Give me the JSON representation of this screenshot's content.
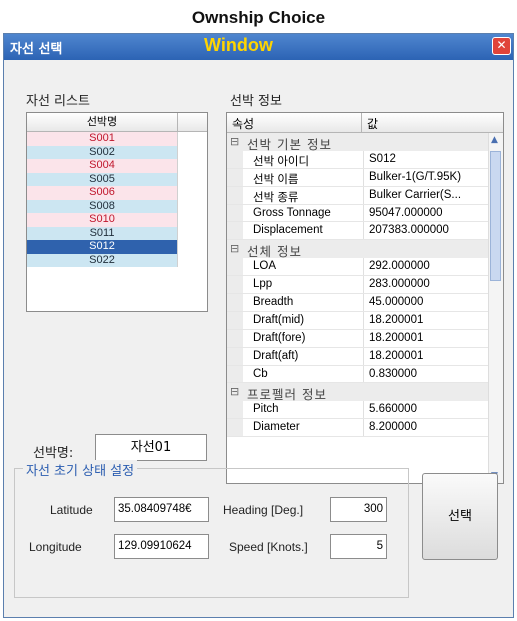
{
  "caption": {
    "line1": "Ownship Choice",
    "line2": "Window"
  },
  "window": {
    "title": "자선 선택",
    "close_glyph": "✕"
  },
  "ship_list": {
    "label": "자선 리스트",
    "column": "선박명",
    "items": [
      "S001",
      "S002",
      "S004",
      "S005",
      "S006",
      "S008",
      "S010",
      "S011",
      "S012",
      "S022"
    ],
    "selected": "S012"
  },
  "ship_name": {
    "label": "선박명:",
    "value": "자선01"
  },
  "ship_info": {
    "label": "선박 정보",
    "columns": {
      "attr": "속성",
      "value": "값"
    },
    "categories": [
      {
        "name": "선박 기본 정보",
        "rows": [
          {
            "key": "선박 아이디",
            "value": "S012"
          },
          {
            "key": "선박 이름",
            "value": "Bulker-1(G/T.95K)"
          },
          {
            "key": "선박 종류",
            "value": "Bulker Carrier(S..."
          },
          {
            "key": "Gross Tonnage",
            "value": "95047.000000"
          },
          {
            "key": "Displacement",
            "value": "207383.000000"
          }
        ]
      },
      {
        "name": "선체 정보",
        "rows": [
          {
            "key": "LOA",
            "value": "292.000000"
          },
          {
            "key": "Lpp",
            "value": "283.000000"
          },
          {
            "key": "Breadth",
            "value": "45.000000"
          },
          {
            "key": "Draft(mid)",
            "value": "18.200001"
          },
          {
            "key": "Draft(fore)",
            "value": "18.200001"
          },
          {
            "key": "Draft(aft)",
            "value": "18.200001"
          },
          {
            "key": "Cb",
            "value": "0.830000"
          }
        ]
      },
      {
        "name": "프로펠러 정보",
        "rows": [
          {
            "key": "Pitch",
            "value": "5.660000"
          },
          {
            "key": "Diameter",
            "value": "8.200000"
          }
        ]
      }
    ]
  },
  "init_state": {
    "title": "자선 초기 상태 설정",
    "latitude": {
      "label": "Latitude",
      "value": "35.08409748€"
    },
    "longitude": {
      "label": "Longitude",
      "value": "129.09910624"
    },
    "heading": {
      "label": "Heading [Deg.]",
      "value": "300"
    },
    "speed": {
      "label": "Speed [Knots.]",
      "value": "5"
    }
  },
  "select_button": {
    "label": "선택"
  }
}
